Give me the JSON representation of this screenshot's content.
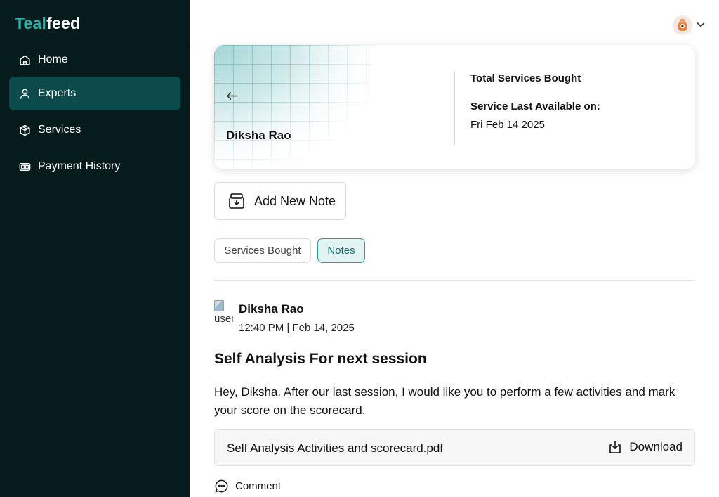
{
  "brand": {
    "part1": "Teal",
    "part2": "feed",
    "accent": "#22b8b0"
  },
  "sidebar": {
    "items": [
      {
        "label": "Home",
        "icon": "home-icon",
        "active": false
      },
      {
        "label": "Experts",
        "icon": "user-icon",
        "active": true
      },
      {
        "label": "Services",
        "icon": "box-icon",
        "active": false
      },
      {
        "label": "Payment History",
        "icon": "payment-icon",
        "active": false
      }
    ]
  },
  "header": {
    "avatar_icon": "user-avatar-icon",
    "menu_icon": "chevron-down-icon"
  },
  "profile": {
    "name": "Diksha Rao",
    "stat_total_label": "Total Services Bought",
    "stat_last_label": "Service Last Available on:",
    "stat_last_value": "Fri Feb 14 2025"
  },
  "actions": {
    "add_note_label": "Add New Note"
  },
  "tabs": [
    {
      "label": "Services Bought",
      "selected": false
    },
    {
      "label": "Notes",
      "selected": true
    }
  ],
  "note": {
    "author": "Diksha Rao",
    "author_img_alt": "user",
    "timestamp": "12:40 PM | Feb 14, 2025",
    "title": "Self Analysis For next session",
    "body": "Hey, Diksha. After our last session, I would like you to perform a few activities and mark your score on the scorecard.",
    "attachment": {
      "filename": "Self Analysis Activities and scorecard.pdf",
      "download_label": "Download"
    },
    "comment_label": "Comment"
  }
}
